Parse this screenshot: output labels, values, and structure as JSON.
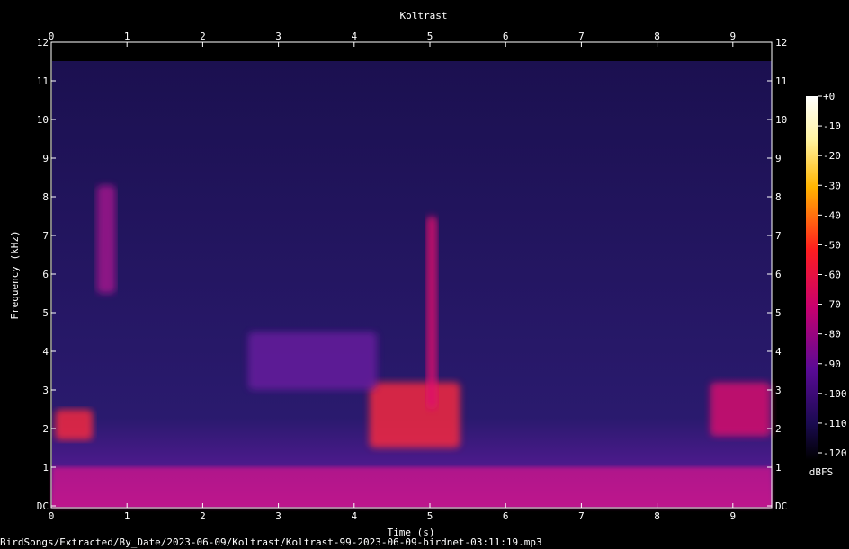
{
  "chart_data": {
    "type": "heatmap",
    "title": "Koltrast",
    "xlabel": "Time (s)",
    "ylabel": "Frequency (kHz)",
    "xlim": [
      0,
      9.5
    ],
    "ylim": [
      0,
      12
    ],
    "x_ticks": [
      "0",
      "1",
      "2",
      "3",
      "4",
      "5",
      "6",
      "7",
      "8",
      "9"
    ],
    "y_ticks": [
      "DC",
      "1",
      "2",
      "3",
      "4",
      "5",
      "6",
      "7",
      "8",
      "9",
      "10",
      "11",
      "12"
    ],
    "colorbar": {
      "label": "dBFS",
      "ticks": [
        "+0",
        "-10",
        "-20",
        "-30",
        "-40",
        "-50",
        "-60",
        "-70",
        "-80",
        "-90",
        "-100",
        "-110",
        "-120"
      ],
      "range": [
        -120,
        0
      ]
    },
    "notable_energy_regions": [
      {
        "t": [
          0.05,
          0.55
        ],
        "f": [
          1.7,
          2.5
        ],
        "level": -55
      },
      {
        "t": [
          0.6,
          0.85
        ],
        "f": [
          5.5,
          8.3
        ],
        "level": -70
      },
      {
        "t": [
          4.2,
          5.4
        ],
        "f": [
          1.5,
          3.2
        ],
        "level": -55
      },
      {
        "t": [
          4.95,
          5.1
        ],
        "f": [
          2.5,
          7.5
        ],
        "level": -65
      },
      {
        "t": [
          8.7,
          9.5
        ],
        "f": [
          1.8,
          3.2
        ],
        "level": -60
      },
      {
        "t": [
          2.6,
          4.3
        ],
        "f": [
          3.0,
          4.5
        ],
        "level": -80
      }
    ]
  },
  "footer": {
    "file_path": "BirdSongs/Extracted/By_Date/2023-06-09/Koltrast/Koltrast-99-2023-06-09-birdnet-03:11:19.mp3"
  }
}
